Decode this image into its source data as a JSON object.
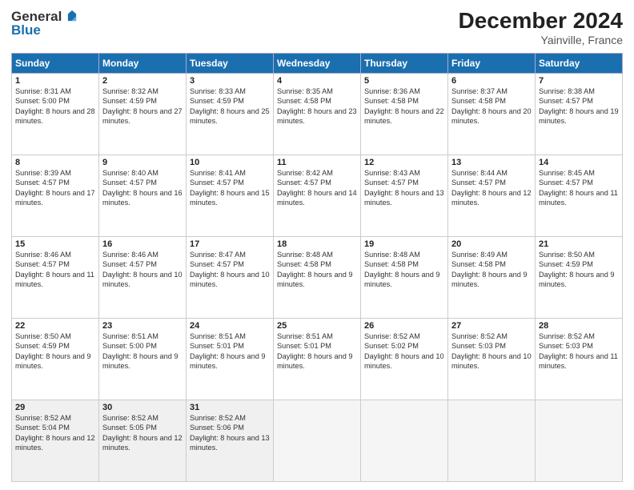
{
  "header": {
    "logo": {
      "general": "General",
      "blue": "Blue"
    },
    "title": "December 2024",
    "location": "Yainville, France"
  },
  "calendar": {
    "days_of_week": [
      "Sunday",
      "Monday",
      "Tuesday",
      "Wednesday",
      "Thursday",
      "Friday",
      "Saturday"
    ],
    "weeks": [
      [
        {
          "num": "1",
          "sunrise": "Sunrise: 8:31 AM",
          "sunset": "Sunset: 5:00 PM",
          "daylight": "Daylight: 8 hours and 28 minutes."
        },
        {
          "num": "2",
          "sunrise": "Sunrise: 8:32 AM",
          "sunset": "Sunset: 4:59 PM",
          "daylight": "Daylight: 8 hours and 27 minutes."
        },
        {
          "num": "3",
          "sunrise": "Sunrise: 8:33 AM",
          "sunset": "Sunset: 4:59 PM",
          "daylight": "Daylight: 8 hours and 25 minutes."
        },
        {
          "num": "4",
          "sunrise": "Sunrise: 8:35 AM",
          "sunset": "Sunset: 4:58 PM",
          "daylight": "Daylight: 8 hours and 23 minutes."
        },
        {
          "num": "5",
          "sunrise": "Sunrise: 8:36 AM",
          "sunset": "Sunset: 4:58 PM",
          "daylight": "Daylight: 8 hours and 22 minutes."
        },
        {
          "num": "6",
          "sunrise": "Sunrise: 8:37 AM",
          "sunset": "Sunset: 4:58 PM",
          "daylight": "Daylight: 8 hours and 20 minutes."
        },
        {
          "num": "7",
          "sunrise": "Sunrise: 8:38 AM",
          "sunset": "Sunset: 4:57 PM",
          "daylight": "Daylight: 8 hours and 19 minutes."
        }
      ],
      [
        {
          "num": "8",
          "sunrise": "Sunrise: 8:39 AM",
          "sunset": "Sunset: 4:57 PM",
          "daylight": "Daylight: 8 hours and 17 minutes."
        },
        {
          "num": "9",
          "sunrise": "Sunrise: 8:40 AM",
          "sunset": "Sunset: 4:57 PM",
          "daylight": "Daylight: 8 hours and 16 minutes."
        },
        {
          "num": "10",
          "sunrise": "Sunrise: 8:41 AM",
          "sunset": "Sunset: 4:57 PM",
          "daylight": "Daylight: 8 hours and 15 minutes."
        },
        {
          "num": "11",
          "sunrise": "Sunrise: 8:42 AM",
          "sunset": "Sunset: 4:57 PM",
          "daylight": "Daylight: 8 hours and 14 minutes."
        },
        {
          "num": "12",
          "sunrise": "Sunrise: 8:43 AM",
          "sunset": "Sunset: 4:57 PM",
          "daylight": "Daylight: 8 hours and 13 minutes."
        },
        {
          "num": "13",
          "sunrise": "Sunrise: 8:44 AM",
          "sunset": "Sunset: 4:57 PM",
          "daylight": "Daylight: 8 hours and 12 minutes."
        },
        {
          "num": "14",
          "sunrise": "Sunrise: 8:45 AM",
          "sunset": "Sunset: 4:57 PM",
          "daylight": "Daylight: 8 hours and 11 minutes."
        }
      ],
      [
        {
          "num": "15",
          "sunrise": "Sunrise: 8:46 AM",
          "sunset": "Sunset: 4:57 PM",
          "daylight": "Daylight: 8 hours and 11 minutes."
        },
        {
          "num": "16",
          "sunrise": "Sunrise: 8:46 AM",
          "sunset": "Sunset: 4:57 PM",
          "daylight": "Daylight: 8 hours and 10 minutes."
        },
        {
          "num": "17",
          "sunrise": "Sunrise: 8:47 AM",
          "sunset": "Sunset: 4:57 PM",
          "daylight": "Daylight: 8 hours and 10 minutes."
        },
        {
          "num": "18",
          "sunrise": "Sunrise: 8:48 AM",
          "sunset": "Sunset: 4:58 PM",
          "daylight": "Daylight: 8 hours and 9 minutes."
        },
        {
          "num": "19",
          "sunrise": "Sunrise: 8:48 AM",
          "sunset": "Sunset: 4:58 PM",
          "daylight": "Daylight: 8 hours and 9 minutes."
        },
        {
          "num": "20",
          "sunrise": "Sunrise: 8:49 AM",
          "sunset": "Sunset: 4:58 PM",
          "daylight": "Daylight: 8 hours and 9 minutes."
        },
        {
          "num": "21",
          "sunrise": "Sunrise: 8:50 AM",
          "sunset": "Sunset: 4:59 PM",
          "daylight": "Daylight: 8 hours and 9 minutes."
        }
      ],
      [
        {
          "num": "22",
          "sunrise": "Sunrise: 8:50 AM",
          "sunset": "Sunset: 4:59 PM",
          "daylight": "Daylight: 8 hours and 9 minutes."
        },
        {
          "num": "23",
          "sunrise": "Sunrise: 8:51 AM",
          "sunset": "Sunset: 5:00 PM",
          "daylight": "Daylight: 8 hours and 9 minutes."
        },
        {
          "num": "24",
          "sunrise": "Sunrise: 8:51 AM",
          "sunset": "Sunset: 5:01 PM",
          "daylight": "Daylight: 8 hours and 9 minutes."
        },
        {
          "num": "25",
          "sunrise": "Sunrise: 8:51 AM",
          "sunset": "Sunset: 5:01 PM",
          "daylight": "Daylight: 8 hours and 9 minutes."
        },
        {
          "num": "26",
          "sunrise": "Sunrise: 8:52 AM",
          "sunset": "Sunset: 5:02 PM",
          "daylight": "Daylight: 8 hours and 10 minutes."
        },
        {
          "num": "27",
          "sunrise": "Sunrise: 8:52 AM",
          "sunset": "Sunset: 5:03 PM",
          "daylight": "Daylight: 8 hours and 10 minutes."
        },
        {
          "num": "28",
          "sunrise": "Sunrise: 8:52 AM",
          "sunset": "Sunset: 5:03 PM",
          "daylight": "Daylight: 8 hours and 11 minutes."
        }
      ],
      [
        {
          "num": "29",
          "sunrise": "Sunrise: 8:52 AM",
          "sunset": "Sunset: 5:04 PM",
          "daylight": "Daylight: 8 hours and 12 minutes."
        },
        {
          "num": "30",
          "sunrise": "Sunrise: 8:52 AM",
          "sunset": "Sunset: 5:05 PM",
          "daylight": "Daylight: 8 hours and 12 minutes."
        },
        {
          "num": "31",
          "sunrise": "Sunrise: 8:52 AM",
          "sunset": "Sunset: 5:06 PM",
          "daylight": "Daylight: 8 hours and 13 minutes."
        },
        null,
        null,
        null,
        null
      ]
    ]
  }
}
